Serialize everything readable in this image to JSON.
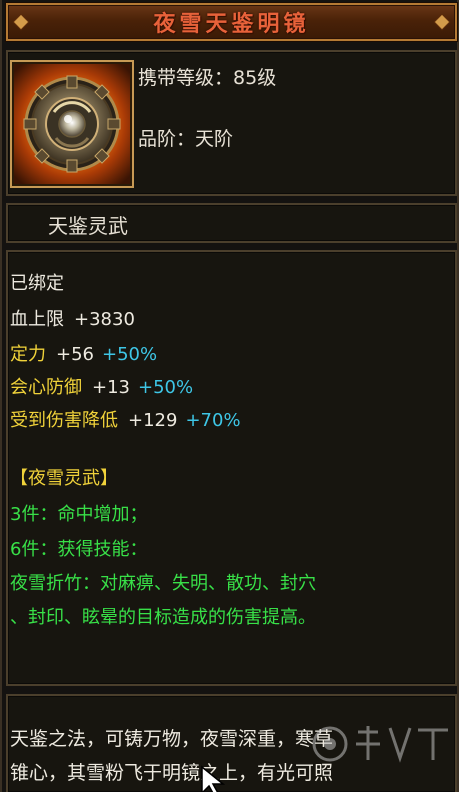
{
  "item": {
    "name": "夜雪天鉴明镜",
    "carry_level_label": "携带等级：",
    "carry_level_value": "85级",
    "grade_label": "品阶：",
    "grade_value": "天阶",
    "category": "天鉴灵武",
    "icon": "bronze-mirror-wheel-icon"
  },
  "stats": {
    "bound": "已绑定",
    "lines": [
      {
        "name": "血上限",
        "value": "+3830",
        "percent": ""
      },
      {
        "name": "定力",
        "value": "+56",
        "percent": "+50%"
      },
      {
        "name": "会心防御",
        "value": "+13",
        "percent": "+50%"
      },
      {
        "name": "受到伤害降低",
        "value": "+129",
        "percent": "+70%"
      }
    ]
  },
  "set": {
    "title": "【夜雪灵武】",
    "bonus_3": "3件：命中增加；",
    "bonus_6": "6件：获得技能：",
    "skill_line_1": "夜雪折竹：对麻痹、失明、散功、封穴",
    "skill_line_2": "、封印、眩晕的目标造成的伤害提高。"
  },
  "description": {
    "line_1": "天鉴之法，可铸万物，夜雪深重，寒草",
    "line_2": "锥心，其雪粉飞于明镜之上，有光可照"
  },
  "colors": {
    "title_text": "#e8623a",
    "yellow_text": "#f0d23a",
    "cyan_text": "#3ec6e6",
    "green_text": "#38e048",
    "frame_border": "#4b3f2c",
    "title_border": "#b57a34"
  }
}
